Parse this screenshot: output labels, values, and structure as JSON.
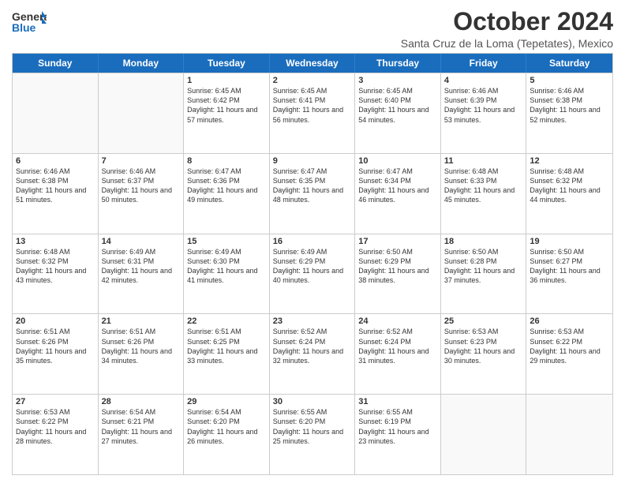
{
  "header": {
    "logo_general": "General",
    "logo_blue": "Blue",
    "title": "October 2024",
    "subtitle": "Santa Cruz de la Loma (Tepetates), Mexico"
  },
  "days_of_week": [
    "Sunday",
    "Monday",
    "Tuesday",
    "Wednesday",
    "Thursday",
    "Friday",
    "Saturday"
  ],
  "weeks": [
    [
      {
        "day": "",
        "info": ""
      },
      {
        "day": "",
        "info": ""
      },
      {
        "day": "1",
        "info": "Sunrise: 6:45 AM\nSunset: 6:42 PM\nDaylight: 11 hours and 57 minutes."
      },
      {
        "day": "2",
        "info": "Sunrise: 6:45 AM\nSunset: 6:41 PM\nDaylight: 11 hours and 56 minutes."
      },
      {
        "day": "3",
        "info": "Sunrise: 6:45 AM\nSunset: 6:40 PM\nDaylight: 11 hours and 54 minutes."
      },
      {
        "day": "4",
        "info": "Sunrise: 6:46 AM\nSunset: 6:39 PM\nDaylight: 11 hours and 53 minutes."
      },
      {
        "day": "5",
        "info": "Sunrise: 6:46 AM\nSunset: 6:38 PM\nDaylight: 11 hours and 52 minutes."
      }
    ],
    [
      {
        "day": "6",
        "info": "Sunrise: 6:46 AM\nSunset: 6:38 PM\nDaylight: 11 hours and 51 minutes."
      },
      {
        "day": "7",
        "info": "Sunrise: 6:46 AM\nSunset: 6:37 PM\nDaylight: 11 hours and 50 minutes."
      },
      {
        "day": "8",
        "info": "Sunrise: 6:47 AM\nSunset: 6:36 PM\nDaylight: 11 hours and 49 minutes."
      },
      {
        "day": "9",
        "info": "Sunrise: 6:47 AM\nSunset: 6:35 PM\nDaylight: 11 hours and 48 minutes."
      },
      {
        "day": "10",
        "info": "Sunrise: 6:47 AM\nSunset: 6:34 PM\nDaylight: 11 hours and 46 minutes."
      },
      {
        "day": "11",
        "info": "Sunrise: 6:48 AM\nSunset: 6:33 PM\nDaylight: 11 hours and 45 minutes."
      },
      {
        "day": "12",
        "info": "Sunrise: 6:48 AM\nSunset: 6:32 PM\nDaylight: 11 hours and 44 minutes."
      }
    ],
    [
      {
        "day": "13",
        "info": "Sunrise: 6:48 AM\nSunset: 6:32 PM\nDaylight: 11 hours and 43 minutes."
      },
      {
        "day": "14",
        "info": "Sunrise: 6:49 AM\nSunset: 6:31 PM\nDaylight: 11 hours and 42 minutes."
      },
      {
        "day": "15",
        "info": "Sunrise: 6:49 AM\nSunset: 6:30 PM\nDaylight: 11 hours and 41 minutes."
      },
      {
        "day": "16",
        "info": "Sunrise: 6:49 AM\nSunset: 6:29 PM\nDaylight: 11 hours and 40 minutes."
      },
      {
        "day": "17",
        "info": "Sunrise: 6:50 AM\nSunset: 6:29 PM\nDaylight: 11 hours and 38 minutes."
      },
      {
        "day": "18",
        "info": "Sunrise: 6:50 AM\nSunset: 6:28 PM\nDaylight: 11 hours and 37 minutes."
      },
      {
        "day": "19",
        "info": "Sunrise: 6:50 AM\nSunset: 6:27 PM\nDaylight: 11 hours and 36 minutes."
      }
    ],
    [
      {
        "day": "20",
        "info": "Sunrise: 6:51 AM\nSunset: 6:26 PM\nDaylight: 11 hours and 35 minutes."
      },
      {
        "day": "21",
        "info": "Sunrise: 6:51 AM\nSunset: 6:26 PM\nDaylight: 11 hours and 34 minutes."
      },
      {
        "day": "22",
        "info": "Sunrise: 6:51 AM\nSunset: 6:25 PM\nDaylight: 11 hours and 33 minutes."
      },
      {
        "day": "23",
        "info": "Sunrise: 6:52 AM\nSunset: 6:24 PM\nDaylight: 11 hours and 32 minutes."
      },
      {
        "day": "24",
        "info": "Sunrise: 6:52 AM\nSunset: 6:24 PM\nDaylight: 11 hours and 31 minutes."
      },
      {
        "day": "25",
        "info": "Sunrise: 6:53 AM\nSunset: 6:23 PM\nDaylight: 11 hours and 30 minutes."
      },
      {
        "day": "26",
        "info": "Sunrise: 6:53 AM\nSunset: 6:22 PM\nDaylight: 11 hours and 29 minutes."
      }
    ],
    [
      {
        "day": "27",
        "info": "Sunrise: 6:53 AM\nSunset: 6:22 PM\nDaylight: 11 hours and 28 minutes."
      },
      {
        "day": "28",
        "info": "Sunrise: 6:54 AM\nSunset: 6:21 PM\nDaylight: 11 hours and 27 minutes."
      },
      {
        "day": "29",
        "info": "Sunrise: 6:54 AM\nSunset: 6:20 PM\nDaylight: 11 hours and 26 minutes."
      },
      {
        "day": "30",
        "info": "Sunrise: 6:55 AM\nSunset: 6:20 PM\nDaylight: 11 hours and 25 minutes."
      },
      {
        "day": "31",
        "info": "Sunrise: 6:55 AM\nSunset: 6:19 PM\nDaylight: 11 hours and 23 minutes."
      },
      {
        "day": "",
        "info": ""
      },
      {
        "day": "",
        "info": ""
      }
    ]
  ]
}
